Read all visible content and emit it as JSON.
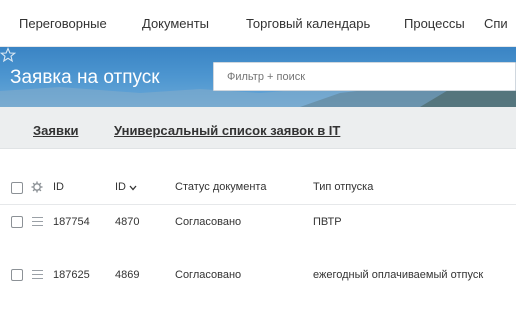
{
  "topnav": {
    "items": [
      "Переговорные",
      "Документы",
      "Торговый календарь",
      "Процессы",
      "Спи"
    ]
  },
  "header": {
    "title": "Заявка на отпуск",
    "search_placeholder": "Фильтр + поиск"
  },
  "subtabs": [
    "Заявки",
    "Универсальный список заявок в IT"
  ],
  "table": {
    "columns": [
      "ID",
      "ID",
      "Статус документа",
      "Тип отпуска"
    ],
    "rows": [
      {
        "id1": "187754",
        "id2": "4870",
        "status": "Согласовано",
        "type": "ПВТР"
      },
      {
        "id1": "187625",
        "id2": "4869",
        "status": "Согласовано",
        "type": "ежегодный оплачиваемый отпуск"
      }
    ]
  },
  "icons": {
    "star": "star-outline-icon",
    "settings": "gear-icon",
    "sort": "chevron-down-icon",
    "row_menu": "hamburger-menu-icon"
  },
  "colors": {
    "banner": "#4a90cf",
    "text": "#333333"
  }
}
